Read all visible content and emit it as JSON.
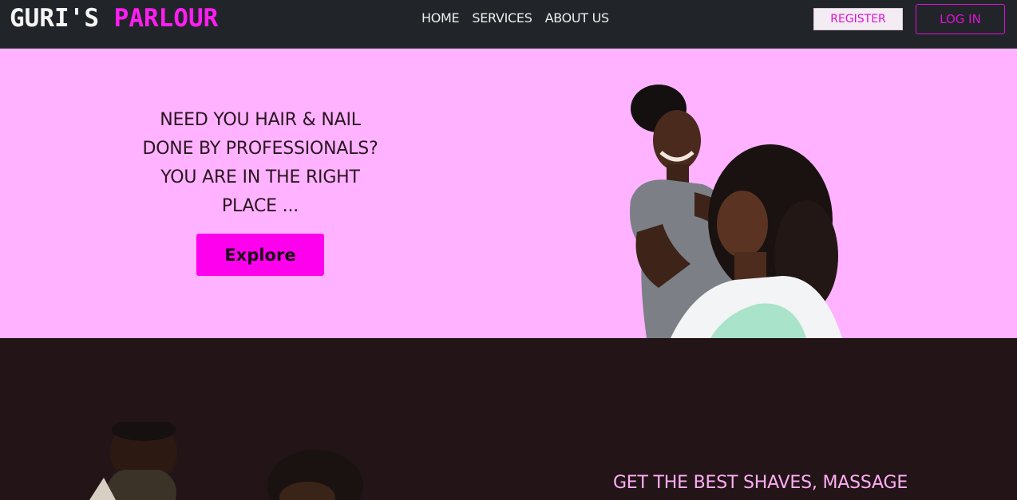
{
  "navbar": {
    "brand_part1": "GURI'S",
    "brand_part2": "PARLOUR",
    "links": [
      "HOME",
      "SERVICES",
      "ABOUT US"
    ],
    "register_label": "REGISTER",
    "login_label": "LOG IN"
  },
  "hero": {
    "lines": [
      "NEED YOU HAIR & NAIL",
      "DONE BY PROFESSIONALS?",
      "YOU ARE IN THE RIGHT",
      "PLACE ..."
    ],
    "explore_label": "Explore"
  },
  "section2": {
    "title": "GET THE BEST SHAVES, MASSAGE"
  },
  "colors": {
    "nav_bg": "#212529",
    "accent": "#ff00ee",
    "hero_bg": "#ffb2ff",
    "dark_bg": "#231417",
    "section2_text": "#ffaef4"
  }
}
